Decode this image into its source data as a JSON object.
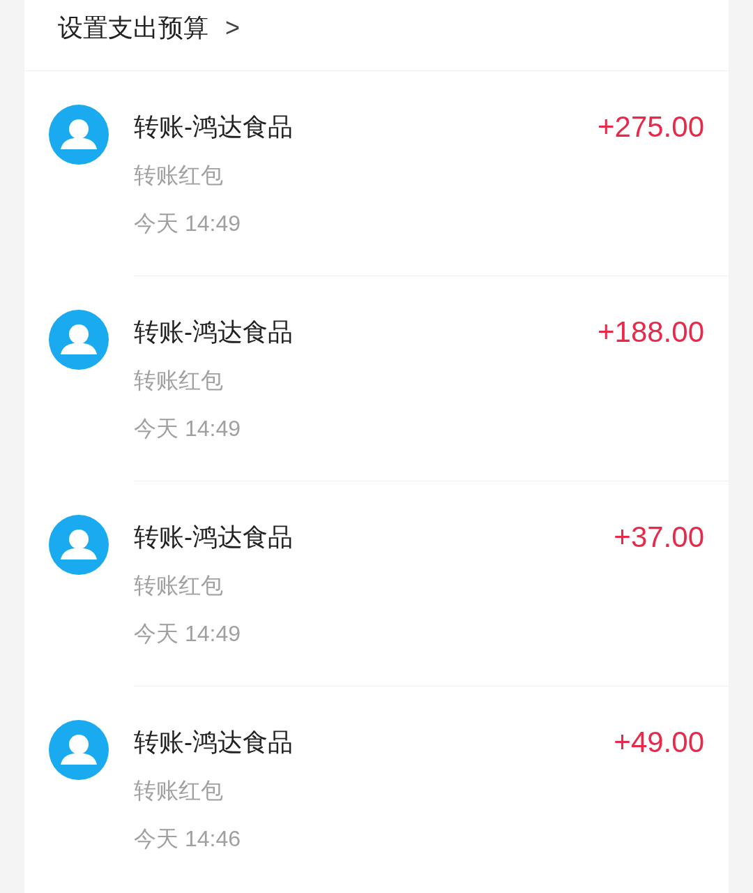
{
  "budget_link": {
    "label": "设置支出预算",
    "chevron": ">"
  },
  "transactions": [
    {
      "title": "转账-鸿达食品",
      "amount": "+275.00",
      "type": "转账红包",
      "time": "今天 14:49"
    },
    {
      "title": "转账-鸿达食品",
      "amount": "+188.00",
      "type": "转账红包",
      "time": "今天 14:49"
    },
    {
      "title": "转账-鸿达食品",
      "amount": "+37.00",
      "type": "转账红包",
      "time": "今天 14:49"
    },
    {
      "title": "转账-鸿达食品",
      "amount": "+49.00",
      "type": "转账红包",
      "time": "今天 14:46"
    }
  ]
}
